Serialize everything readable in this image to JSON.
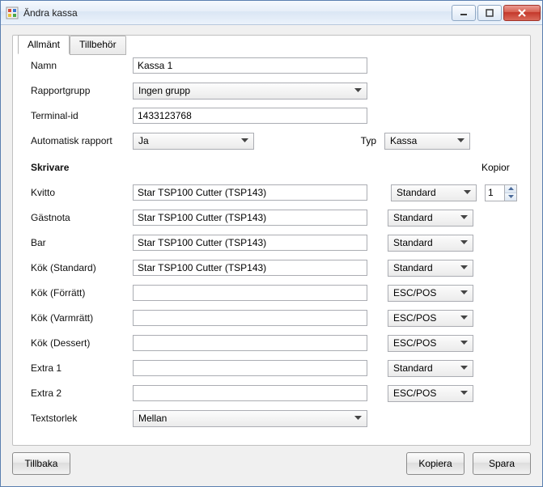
{
  "window": {
    "title": "Ändra kassa"
  },
  "tabs": {
    "general": "Allmänt",
    "accessories": "Tillbehör"
  },
  "labels": {
    "name": "Namn",
    "report_group": "Rapportgrupp",
    "terminal_id": "Terminal-id",
    "auto_report": "Automatisk rapport",
    "type": "Typ",
    "printers": "Skrivare",
    "kopior": "Kopior",
    "receipt": "Kvitto",
    "guestnote": "Gästnota",
    "bar": "Bar",
    "kitchen_std": "Kök (Standard)",
    "kitchen_starter": "Kök (Förrätt)",
    "kitchen_main": "Kök (Varmrätt)",
    "kitchen_dessert": "Kök (Dessert)",
    "extra1": "Extra 1",
    "extra2": "Extra 2",
    "textsize": "Textstorlek"
  },
  "values": {
    "name": "Kassa 1",
    "report_group": "Ingen grupp",
    "terminal_id": "1433123768",
    "auto_report": "Ja",
    "type": "Kassa",
    "kopior": "1",
    "textsize": "Mellan"
  },
  "printers": {
    "receipt": {
      "device": "Star TSP100 Cutter (TSP143)",
      "format": "Standard"
    },
    "guestnote": {
      "device": "Star TSP100 Cutter (TSP143)",
      "format": "Standard"
    },
    "bar": {
      "device": "Star TSP100 Cutter (TSP143)",
      "format": "Standard"
    },
    "kitchen_std": {
      "device": "Star TSP100 Cutter (TSP143)",
      "format": "Standard"
    },
    "kitchen_starter": {
      "device": "",
      "format": "ESC/POS"
    },
    "kitchen_main": {
      "device": "",
      "format": "ESC/POS"
    },
    "kitchen_dessert": {
      "device": "",
      "format": "ESC/POS"
    },
    "extra1": {
      "device": "",
      "format": "Standard"
    },
    "extra2": {
      "device": "",
      "format": "ESC/POS"
    }
  },
  "buttons": {
    "back": "Tillbaka",
    "copy": "Kopiera",
    "save": "Spara"
  }
}
